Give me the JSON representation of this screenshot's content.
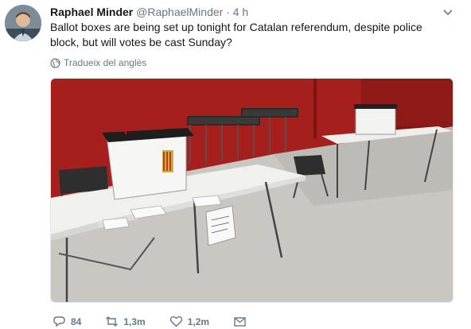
{
  "tweet": {
    "author_name": "Raphael Minder",
    "author_handle": "@RaphaelMinder",
    "separator": "·",
    "time": "4 h",
    "text": "Ballot boxes are being set up tonight for Catalan referendum, despite police block, but will votes be cast Sunday?",
    "translate_label": "Tradueix del anglès"
  },
  "icons": {
    "caret": "chevron-down-icon",
    "translate": "globe-icon",
    "reply": "reply-icon",
    "retweet": "retweet-icon",
    "like": "heart-icon",
    "message": "envelope-icon"
  },
  "actions": {
    "reply_count": "84",
    "retweet_count": "1,3m",
    "like_count": "1,2m"
  },
  "colors": {
    "text": "#14171a",
    "muted": "#657786",
    "wall_red": "#a5201c",
    "floor": "#c9c7c2"
  }
}
